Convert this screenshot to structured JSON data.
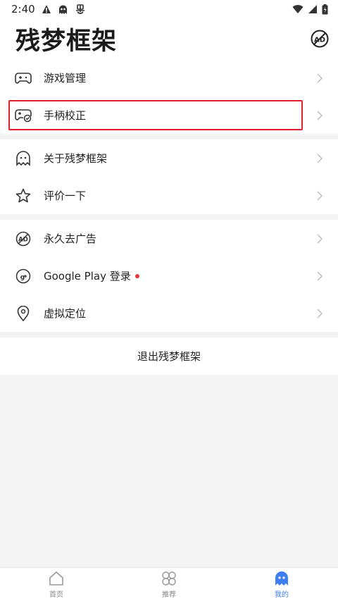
{
  "status_bar": {
    "time": "2:40"
  },
  "header": {
    "title": "残梦框架"
  },
  "sections": [
    {
      "items": [
        {
          "label": "游戏管理"
        },
        {
          "label": "手柄校正"
        }
      ]
    },
    {
      "items": [
        {
          "label": "关于残梦框架"
        },
        {
          "label": "评价一下"
        }
      ]
    },
    {
      "items": [
        {
          "label": "永久去广告"
        },
        {
          "label": "Google Play 登录"
        },
        {
          "label": "虚拟定位"
        }
      ]
    }
  ],
  "logout_label": "退出残梦框架",
  "bottom_nav": [
    {
      "label": "首页"
    },
    {
      "label": "推荐"
    },
    {
      "label": "我的"
    }
  ],
  "colors": {
    "accent": "#3f7ef0",
    "highlight": "#e0202c",
    "badge": "#e53935"
  }
}
